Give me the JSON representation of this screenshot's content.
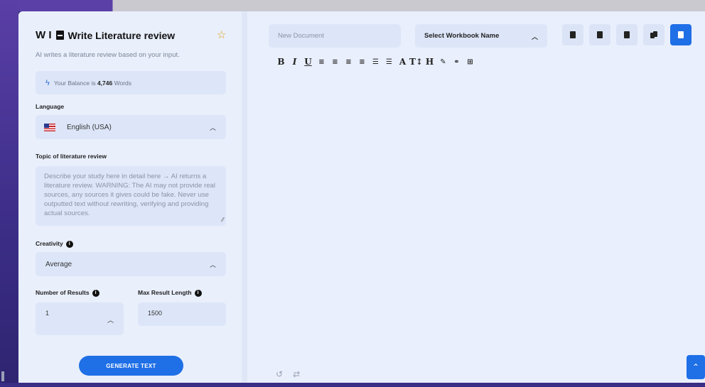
{
  "panel": {
    "title_prefix": "W I",
    "title": "Write Literature review",
    "subtitle": "AI writes a literature review based on your input.",
    "balance_prefix": "Your Balance is ",
    "balance_value": "4,746",
    "balance_suffix": " Words",
    "language_label": "Language",
    "language_value": "English (USA)",
    "topic_label": "Topic of literature review",
    "topic_placeholder": "Describe your study here in detail here → AI returns a literature review. WARNING: The AI may not provide real sources, any sources it gives could be fake. Never use outputted text without rewriting, verifying and providing actual sources.",
    "creativity_label": "Creativity",
    "creativity_value": "Average",
    "num_results_label": "Number of Results",
    "num_results_value": "1",
    "max_length_label": "Max Result Length",
    "max_length_value": "1500",
    "generate_label": "GENERATE TEXT"
  },
  "editor": {
    "doc_name_placeholder": "New Document",
    "workbook_select": "Select Workbook Name",
    "format_buttons": [
      "B",
      "I",
      "U",
      "≡",
      "≡",
      "≡",
      "≡",
      "☰",
      "☰",
      "A",
      "T↕",
      "H",
      "✎",
      "⚭",
      "⊞"
    ]
  },
  "colors": {
    "accent": "#1f6fe6",
    "panel_bg": "#e9effb",
    "field_bg": "#dde6f8",
    "star": "#e0a21a"
  }
}
